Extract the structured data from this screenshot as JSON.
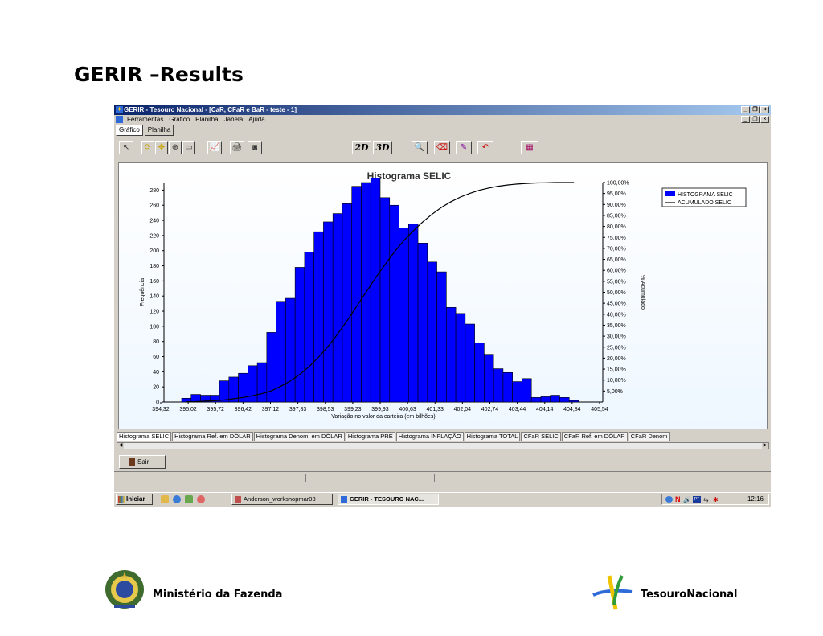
{
  "slide": {
    "title": "GERIR –Results",
    "footer_left": "Ministério da Fazenda",
    "footer_right": "TesouroNacional"
  },
  "window": {
    "title": "GERIR - Tesouro Nacional - [CaR, CFaR e BaR - teste - 1]",
    "menu": [
      "Ferramentas",
      "Gráfico",
      "Planilha",
      "Janela",
      "Ajuda"
    ],
    "view_tabs": [
      "Gráfico",
      "Planilha"
    ],
    "toolbar_2d": "2D",
    "toolbar_3d": "3D",
    "sheet_tabs": [
      "Histograma SELIC",
      "Histograma Ref. em DÓLAR",
      "Histograma Denom. em DÓLAR",
      "Histograma PRÉ",
      "Histograma INFLAÇÃO",
      "Histograma TOTAL",
      "CFaR SELIC",
      "CFaR Ref. em DÓLAR",
      "CFaR Denom"
    ],
    "exit_button": "Sair"
  },
  "taskbar": {
    "start": "Iniciar",
    "task1": "Anderson_workshopmar03",
    "task2": "GERIR - TESOURO NAC...",
    "clock": "12:16"
  },
  "chart_data": {
    "type": "bar",
    "title": "Histograma SELIC",
    "xlabel": "Variação no valor da carteira (em bilhões)",
    "ylabel": "Frequência",
    "y2label": "% Acumulado",
    "ylim": [
      0,
      290
    ],
    "y2lim": [
      0,
      100
    ],
    "x_ticks": [
      "394,32",
      "395,02",
      "395,72",
      "396,42",
      "397,12",
      "397,83",
      "398,53",
      "399,23",
      "399,93",
      "400,63",
      "401,33",
      "402,04",
      "402,74",
      "403,44",
      "404,14",
      "404,84",
      "405,54"
    ],
    "y_ticks": [
      0,
      20,
      40,
      60,
      80,
      100,
      120,
      140,
      160,
      180,
      200,
      220,
      240,
      260,
      280
    ],
    "y2_ticks": [
      "5,00%",
      "10,00%",
      "15,00%",
      "20,00%",
      "25,00%",
      "30,00%",
      "35,00%",
      "40,00%",
      "45,00%",
      "50,00%",
      "55,00%",
      "60,00%",
      "65,00%",
      "70,00%",
      "75,00%",
      "80,00%",
      "85,00%",
      "90,00%",
      "95,00%",
      "100,00%"
    ],
    "legend_position": "top-right",
    "series": [
      {
        "name": "HISTOGRAMA SELIC",
        "type": "bar",
        "color": "#0000ff",
        "values": [
          5,
          10,
          9,
          9,
          28,
          33,
          38,
          48,
          52,
          92,
          133,
          137,
          178,
          198,
          225,
          238,
          249,
          262,
          285,
          290,
          296,
          270,
          260,
          230,
          235,
          210,
          185,
          172,
          125,
          117,
          103,
          78,
          63,
          44,
          39,
          27,
          31,
          6,
          7,
          9,
          6,
          2
        ]
      },
      {
        "name": "ACUMULADO SELIC",
        "type": "line",
        "color": "#000000",
        "values": [
          0.1,
          0.2,
          0.4,
          0.6,
          0.9,
          1.5,
          2.1,
          2.9,
          3.8,
          5.1,
          7.2,
          9.6,
          12.6,
          16.2,
          20.5,
          25.4,
          31.0,
          37.0,
          43.5,
          50.0,
          56.5,
          62.6,
          68.3,
          73.5,
          78.0,
          82.0,
          85.6,
          88.7,
          91.3,
          93.4,
          95.1,
          96.5,
          97.5,
          98.3,
          98.9,
          99.3,
          99.6,
          99.8,
          99.9,
          100.0,
          100.0,
          100.0
        ]
      }
    ]
  }
}
